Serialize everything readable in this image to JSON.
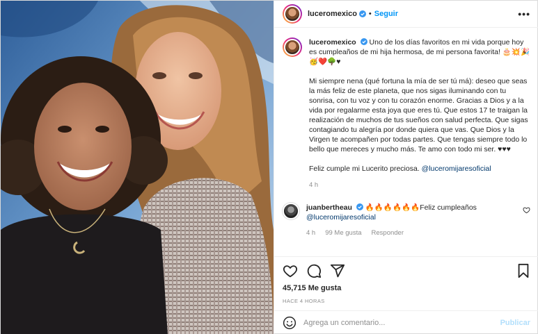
{
  "header": {
    "username": "luceromexico",
    "dot": "•",
    "follow_label": "Seguir",
    "more_label": "•••"
  },
  "caption": {
    "username": "luceromexico",
    "paragraph1": "Uno de los días favoritos en mi vida porque hoy es cumpleaños de mi hija hermosa, de mi persona favorita! 🎂💥🎉 🥳❤️🌳♥",
    "paragraph2": "Mi siempre nena (qué fortuna la mía de ser tú má): deseo que seas la más feliz de este planeta, que nos sigas iluminando con tu sonrisa, con tu voz y con tu corazón enorme. Gracias a Dios y a la vida por regalarme esta joya que eres tú. Que estos 17 te traigan la realización de muchos de tus sueños con salud perfecta. Que sigas contagiando tu alegría por donde quiera que vas. Que Dios y la Virgen te acompañen por todas partes. Que tengas siempre todo lo bello que mereces y mucho más. Te amo con todo mi ser. ♥♥♥",
    "paragraph3_text": "Feliz cumple mi Lucerito preciosa. ",
    "paragraph3_mention": "@luceromijaresoficial",
    "time": "4 h"
  },
  "comment": {
    "username": "juanbertheau",
    "text": "🔥🔥🔥🔥🔥🔥Feliz cumpleaños ",
    "mention": "@luceromijaresoficial",
    "time": "4 h",
    "likes": "99 Me gusta",
    "reply": "Responder"
  },
  "actions": {
    "likes_count": "45,715 Me gusta",
    "ago": "HACE 4 HORAS"
  },
  "add_comment": {
    "placeholder": "Agrega un comentario...",
    "publish_label": "Publicar"
  },
  "colors": {
    "accent": "#0095f6",
    "verified": "#3897f0",
    "mention": "#00376b",
    "muted": "#8e8e8e",
    "publish_disabled": "#b2dffc"
  }
}
